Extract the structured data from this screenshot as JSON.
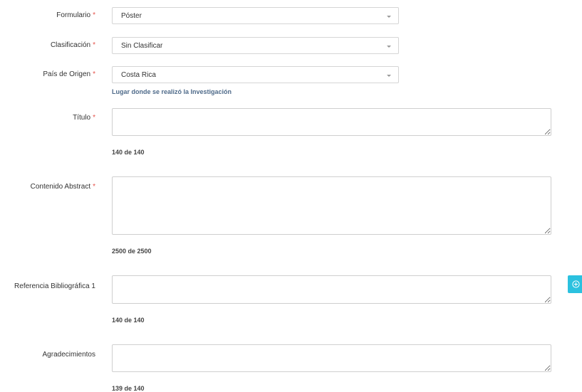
{
  "form": {
    "formulario": {
      "label": "Formulario",
      "required": "*",
      "value": "Póster"
    },
    "clasificacion": {
      "label": "Clasificación",
      "required": "*",
      "value": "Sin Clasificar"
    },
    "pais": {
      "label": "País de Origen",
      "required": "*",
      "value": "Costa Rica",
      "hint": "Lugar donde se realizó la Investigación"
    },
    "titulo": {
      "label": "Título",
      "required": "*",
      "value": "",
      "counter": "140 de 140"
    },
    "abstract": {
      "label": "Contenido Abstract",
      "required": "*",
      "value": "",
      "counter": "2500 de 2500"
    },
    "referencia": {
      "label": "Referencia Bibliográfica 1",
      "value": "",
      "counter": "140 de 140"
    },
    "agradecimientos": {
      "label": "Agradecimientos",
      "value": "",
      "counter": "139 de 140"
    }
  },
  "icons": {
    "add_reference": "plus-circle-icon",
    "dropdown": "caret-down-icon"
  },
  "colors": {
    "required": "#e5534b",
    "hint": "#4f6b8a",
    "add_button": "#2bc1df"
  }
}
